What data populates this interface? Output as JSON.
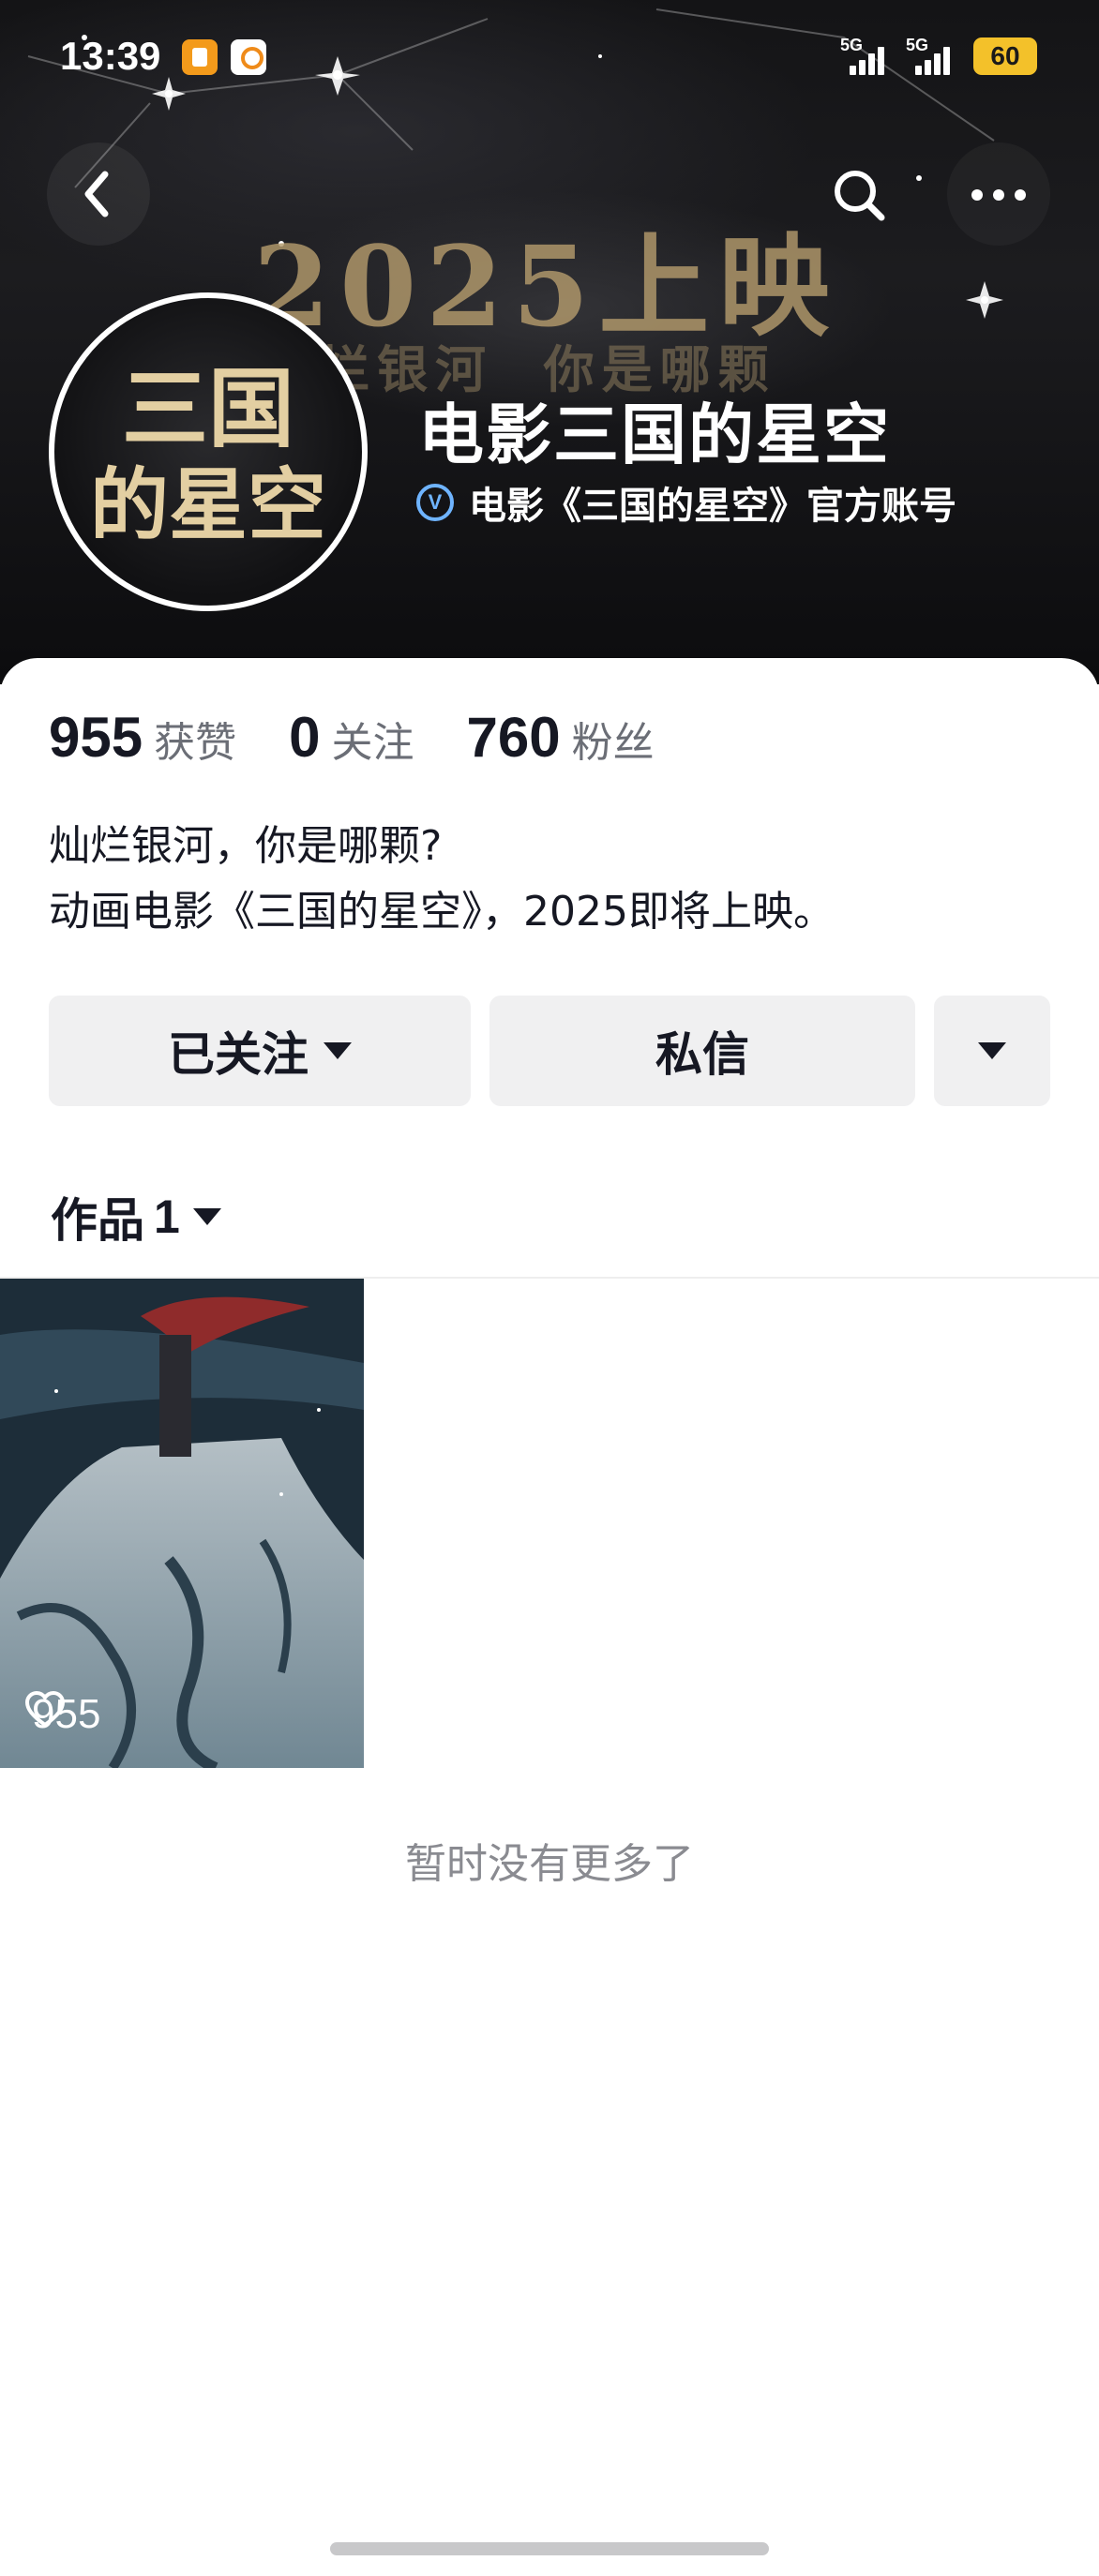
{
  "status_bar": {
    "time": "13:39",
    "sim1_label": "5G",
    "sim2_label": "5G",
    "battery": "60"
  },
  "banner": {
    "headline": "2025上映",
    "subline": "烂银河  你是哪颗"
  },
  "nav": {
    "back_icon": "chevron-left-icon",
    "search_icon": "search-icon",
    "more_icon": "more-dots-icon"
  },
  "profile": {
    "avatar_text": "三国的星空",
    "name": "电影三国的星空",
    "verified_text": "电影《三国的星空》官方账号",
    "verified_icon": "V"
  },
  "stats": [
    {
      "value": "955",
      "label": "获赞"
    },
    {
      "value": "0",
      "label": "关注"
    },
    {
      "value": "760",
      "label": "粉丝"
    }
  ],
  "bio": {
    "line1": "灿烂银河，你是哪颗?",
    "line2": "动画电影《三国的星空》，2025即将上映。"
  },
  "actions": {
    "follow_label": "已关注",
    "message_label": "私信"
  },
  "works": {
    "label": "作品",
    "count": "1"
  },
  "videos": [
    {
      "likes": "955"
    }
  ],
  "footer": {
    "no_more": "暂时没有更多了"
  },
  "colors": {
    "accent_verify": "#6fb4ff",
    "battery": "#f3c12a",
    "button_bg": "#f0f0f1"
  }
}
